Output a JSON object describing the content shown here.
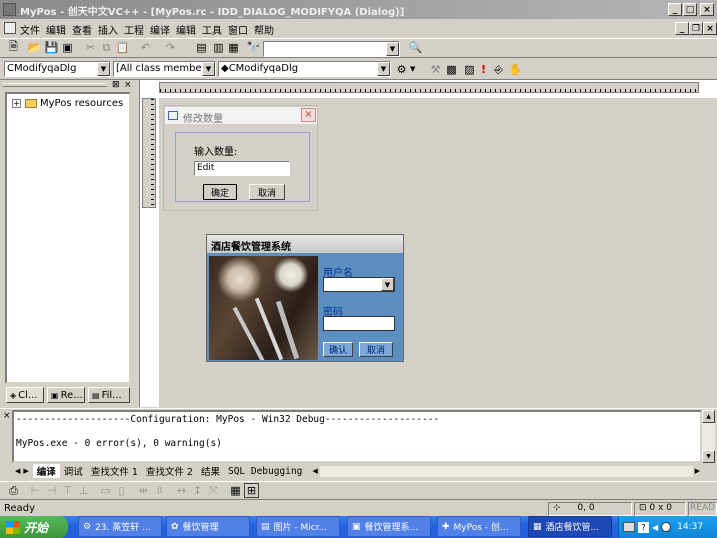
{
  "title": "MyPos - 创天中文VC++ - [MyPos.rc - IDD_DIALOG_MODIFYQA (Dialog)]",
  "menu": [
    "文件",
    "编辑",
    "查看",
    "插入",
    "工程",
    "编译",
    "编辑",
    "工具",
    "窗口",
    "帮助"
  ],
  "wizard": {
    "class": "CModifyqaDlg",
    "filter": "[All class members]",
    "member": "◆CModifyqaDlg"
  },
  "tree": {
    "root": "MyPos resources"
  },
  "ws_tabs": [
    "Cl...",
    "Re...",
    "Fil..."
  ],
  "dialog1": {
    "title": "修改数量",
    "prompt": "输入数量:",
    "edit_value": "Edit",
    "ok": "确定",
    "cancel": "取消"
  },
  "dialog2": {
    "title": "酒店餐饮管理系统",
    "user_label": "用户名",
    "pwd_label": "密码",
    "ok": "确认",
    "cancel": "取消"
  },
  "output": {
    "line1": "--------------------Configuration: MyPos - Win32 Debug--------------------",
    "line2": "MyPos.exe - 0 error(s), 0 warning(s)",
    "tabs": [
      "编译",
      "调试",
      "查找文件 1",
      "查找文件 2",
      "结果",
      "SQL Debugging"
    ]
  },
  "status": {
    "ready": "Ready",
    "pos": "0, 0",
    "size": "0 x 0",
    "mode": "READ"
  },
  "taskbar": {
    "start": "开始",
    "tasks": [
      "23. 蒸笠轩 ...",
      "餐饮管理",
      "图片 - Micr...",
      "餐饮管理系...",
      "MyPos - 创...",
      "酒店餐饮管..."
    ],
    "clock": "14:37"
  }
}
